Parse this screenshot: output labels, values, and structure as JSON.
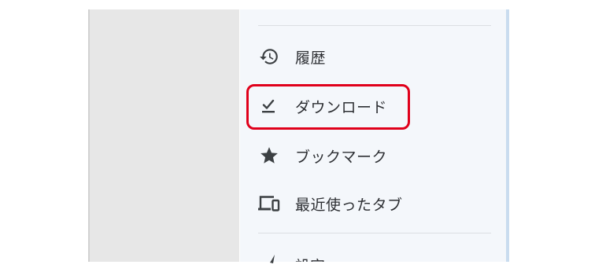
{
  "menu": {
    "items": [
      {
        "label": "履歴",
        "icon": "history-icon"
      },
      {
        "label": "ダウンロード",
        "icon": "download-check-icon"
      },
      {
        "label": "ブックマーク",
        "icon": "star-icon"
      },
      {
        "label": "最近使ったタブ",
        "icon": "devices-icon"
      }
    ],
    "partial_item": {
      "label": "設定",
      "icon": "settings-icon"
    }
  },
  "highlight": {
    "target": "ダウンロード",
    "color": "#e0001b"
  },
  "colors": {
    "icon": "#3c4043",
    "menu_background": "#f4f7fb",
    "left_pane": "#e7e7e7"
  }
}
